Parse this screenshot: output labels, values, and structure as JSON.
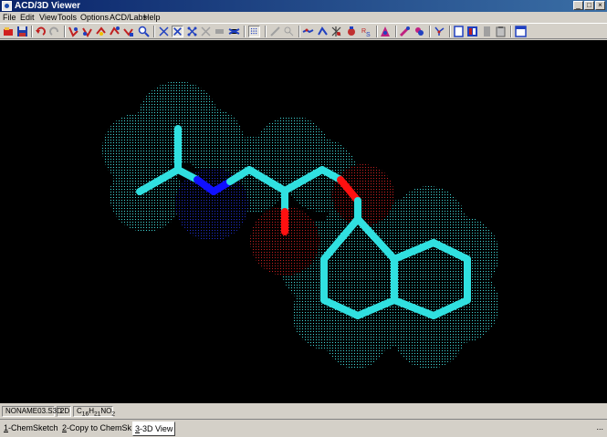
{
  "window": {
    "title": "ACD/3D Viewer",
    "min": "_",
    "max": "□",
    "close": "×"
  },
  "menu": [
    "File",
    "Edit",
    "View",
    "Tools",
    "Options",
    "ACD/Labs",
    "Help"
  ],
  "colors": {
    "carbon": "#30e0e0",
    "nitrogen": "#1010ff",
    "oxygen": "#ff1010",
    "surface_carbon": "#40d8d8",
    "surface_nitrogen": "#2030d0",
    "surface_oxygen": "#c82020"
  },
  "toolbar_icons": [
    "open-icon",
    "save-icon",
    "undo-icon",
    "redo-icon",
    "rotate-x-icon",
    "rotate-y-icon",
    "rotate-z-icon",
    "rotate-free-icon",
    "translate-icon",
    "zoom-icon",
    "wireframe-icon",
    "sticks-icon",
    "balls-sticks-icon",
    "spacefill-icon",
    "disabled-icon",
    "dots-icon",
    "surface-icon",
    "measure-distance-icon",
    "measure-angle-icon",
    "measure-torsion-icon",
    "stereo-icon",
    "rs-label-icon",
    "atoms-icon",
    "color-icon",
    "molecule-icon",
    "dot-surface-icon",
    "page-icon",
    "panel-icon",
    "book-icon",
    "clipboard-icon",
    "window-icon"
  ],
  "status": {
    "file": "NONAME03.S3D",
    "mode": "2D",
    "formula": "C16H21NO2",
    "formula_parts": {
      "c": "C",
      "c_n": "16",
      "h": "H",
      "h_n": "21",
      "n": "NO",
      "o_n": "2"
    }
  },
  "tabs": [
    {
      "key": "1",
      "label": "-ChemSketch"
    },
    {
      "key": "2",
      "label": "-Copy to ChemSk"
    },
    {
      "key": "3",
      "label": "-3D View"
    }
  ],
  "tab_more": "..."
}
